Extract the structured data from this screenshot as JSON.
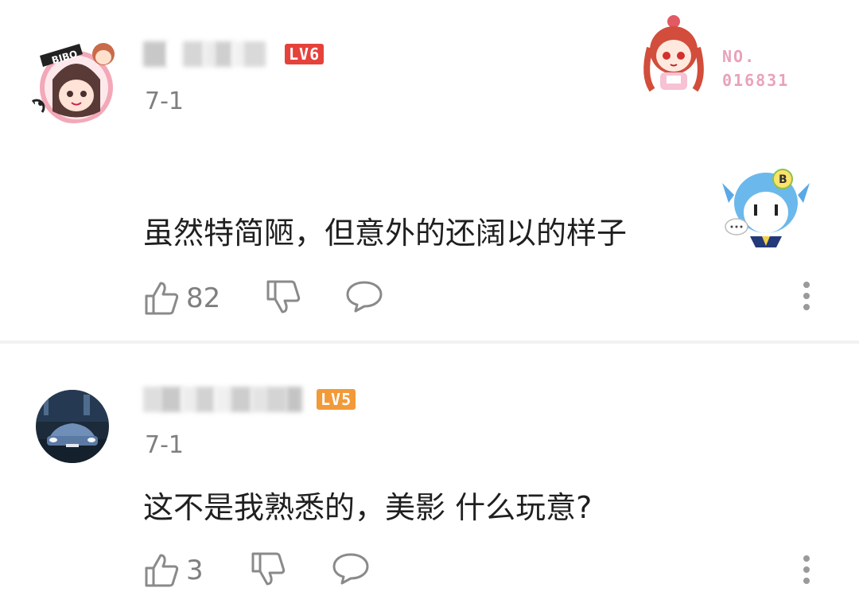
{
  "comments": [
    {
      "level": "LV6",
      "level_color": "#e5423b",
      "date": "7-1",
      "text": "虽然特简陋，但意外的还阔以的样子",
      "likes": "82",
      "badge": {
        "line1": "NO.",
        "line2": "016831",
        "color": "#e9a2ba"
      },
      "avatar_text": "BIBO"
    },
    {
      "level": "LV5",
      "level_color": "#f29a38",
      "date": "7-1",
      "text": "这不是我熟悉的，美影 什么玩意?",
      "likes": "3"
    }
  ],
  "icons": {
    "like": "thumbs-up-icon",
    "dislike": "thumbs-down-icon",
    "reply": "speech-bubble-icon",
    "more": "vertical-dots-icon",
    "emoji": "bilibili-22-emoji-icon"
  }
}
